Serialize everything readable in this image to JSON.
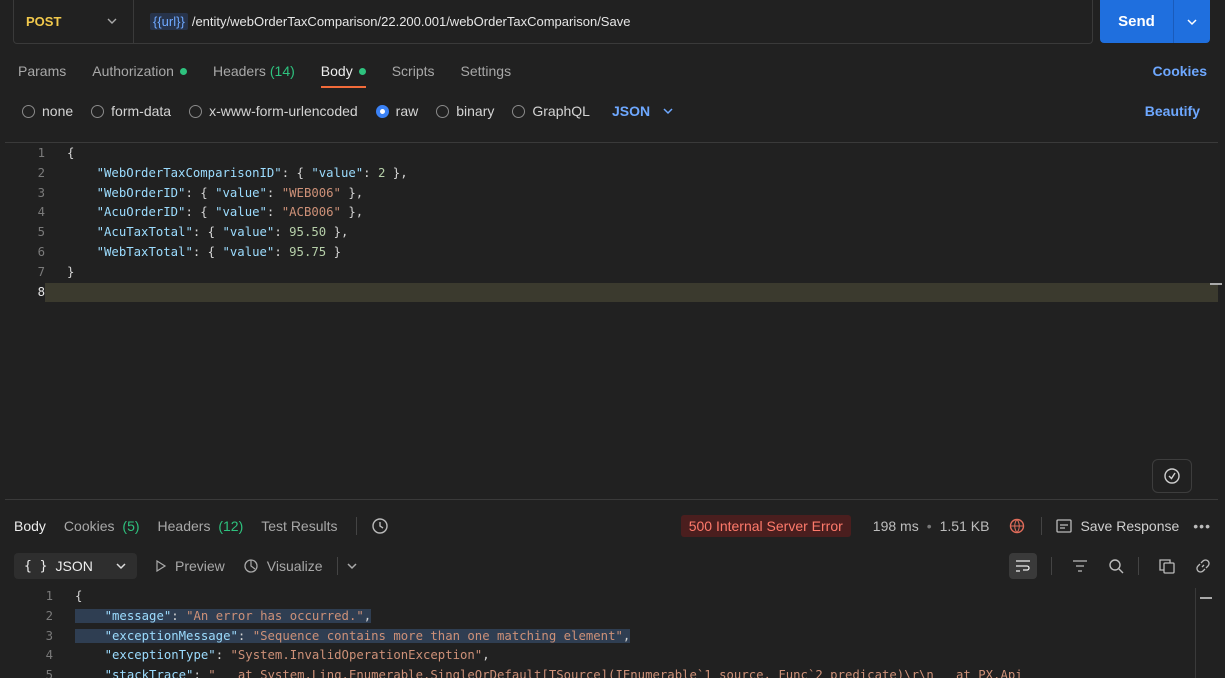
{
  "request": {
    "method": "POST",
    "url_var": "{{url}}",
    "url_path": "/entity/webOrderTaxComparison/22.200.001/webOrderTaxComparison/Save",
    "send_label": "Send"
  },
  "req_tabs": [
    {
      "label": "Params"
    },
    {
      "label": "Authorization"
    },
    {
      "label": "Headers"
    },
    {
      "label": "Body"
    },
    {
      "label": "Scripts"
    },
    {
      "label": "Settings"
    }
  ],
  "headers_count": "(14)",
  "cookies_link": "Cookies",
  "body_types": {
    "none": "none",
    "form_data": "form-data",
    "urlencoded": "x-www-form-urlencoded",
    "raw": "raw",
    "binary": "binary",
    "graphql": "GraphQL",
    "format": "JSON",
    "beautify": "Beautify"
  },
  "request_body": [
    {
      "n": "1",
      "text": "{"
    },
    {
      "n": "2",
      "key": "\"WebOrderTaxComparisonID\"",
      "pre": ": { ",
      "vk": "\"value\"",
      "mid": ": ",
      "val": "2",
      "vtype": "n",
      "post": " },"
    },
    {
      "n": "3",
      "key": "\"WebOrderID\"",
      "pre": ": { ",
      "vk": "\"value\"",
      "mid": ": ",
      "val": "\"WEB006\"",
      "vtype": "s",
      "post": " },"
    },
    {
      "n": "4",
      "key": "\"AcuOrderID\"",
      "pre": ": { ",
      "vk": "\"value\"",
      "mid": ": ",
      "val": "\"ACB006\"",
      "vtype": "s",
      "post": " },"
    },
    {
      "n": "5",
      "key": "\"AcuTaxTotal\"",
      "pre": ": { ",
      "vk": "\"value\"",
      "mid": ": ",
      "val": "95.50",
      "vtype": "n",
      "post": " },"
    },
    {
      "n": "6",
      "key": "\"WebTaxTotal\"",
      "pre": ": { ",
      "vk": "\"value\"",
      "mid": ": ",
      "val": "95.75",
      "vtype": "n",
      "post": " }"
    },
    {
      "n": "7",
      "text": "}"
    },
    {
      "n": "8",
      "text": ""
    }
  ],
  "response": {
    "tabs": {
      "body": "Body",
      "cookies": "Cookies",
      "cookies_count": "(5)",
      "headers": "Headers",
      "headers_count": "(12)",
      "tests": "Test Results"
    },
    "status": "500 Internal Server Error",
    "time": "198 ms",
    "size": "1.51 KB",
    "save": "Save Response",
    "format": "JSON",
    "preview": "Preview",
    "visualize": "Visualize"
  },
  "response_body": [
    {
      "n": "1",
      "text": "{"
    },
    {
      "n": "2",
      "key": "\"message\"",
      "mid": ": ",
      "val": "\"An error has occurred.\"",
      "post": ","
    },
    {
      "n": "3",
      "key": "\"exceptionMessage\"",
      "mid": ": ",
      "val": "\"Sequence contains more than one matching element\"",
      "post": ","
    },
    {
      "n": "4",
      "key": "\"exceptionType\"",
      "mid": ": ",
      "val": "\"System.InvalidOperationException\"",
      "post": ","
    },
    {
      "n": "5",
      "key": "\"stackTrace\"",
      "mid": ": ",
      "val": "\"   at System.Linq.Enumerable.SingleOrDefault[TSource](IEnumerable`1 source, Func`2 predicate)\\r\\n   at PX.Api",
      "post": ""
    }
  ]
}
